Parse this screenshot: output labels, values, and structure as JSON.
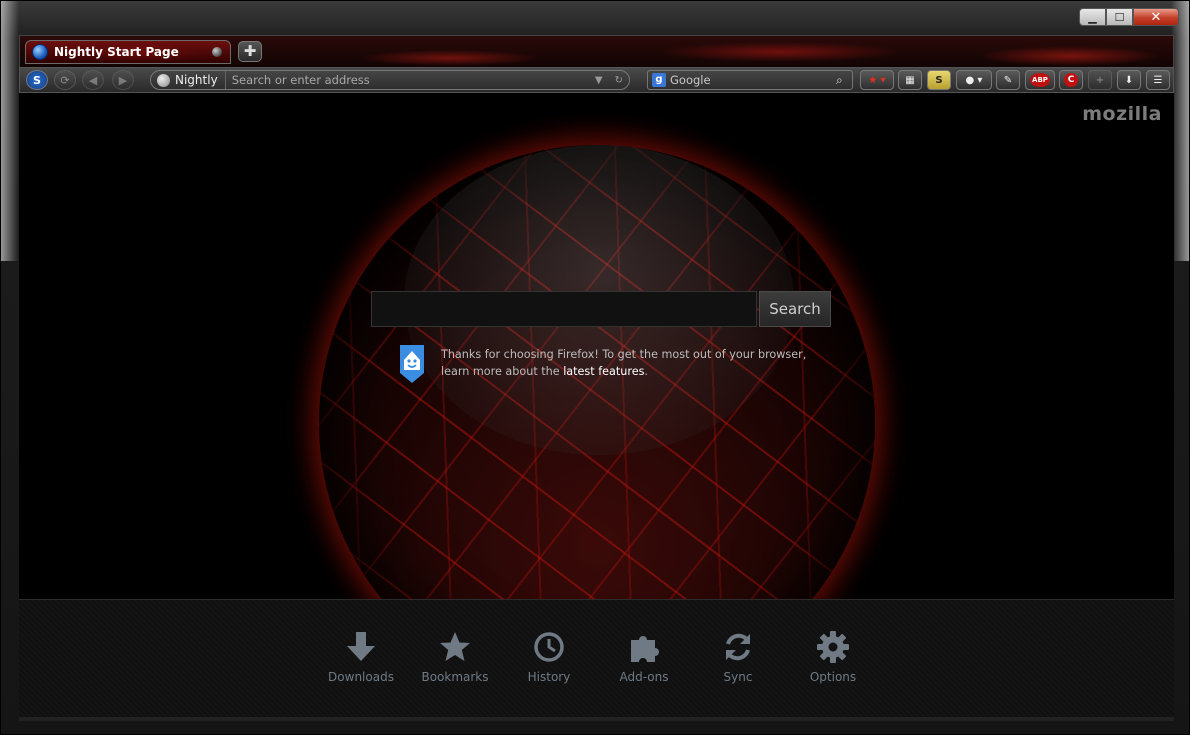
{
  "window": {
    "caption_buttons": {
      "minimize": "▁",
      "maximize": "☐",
      "close": "✕"
    }
  },
  "tabs": [
    {
      "title": "Nightly Start Page",
      "icon": "globe-icon"
    }
  ],
  "new_tab_symbol": "✚",
  "navbar": {
    "identity_label": "Nightly",
    "address_placeholder": "Search or enter address",
    "search_engine": "Google",
    "search_placeholder": "Google",
    "toolbar_icons": [
      "bookmark-star-icon",
      "tile-view-icon",
      "scrapbook-icon",
      "extension-icon",
      "wrench-icon",
      "adblock-plus-icon",
      "c-extension-icon",
      "add-icon",
      "downloads-icon",
      "menu-icon"
    ],
    "abp_label": "ABP",
    "c_label": "C"
  },
  "content": {
    "brand": "mozilla",
    "search_button": "Search",
    "snippet_text": "Thanks for choosing Firefox! To get the most out of your browser, learn more about the ",
    "snippet_link": "latest features",
    "snippet_end": "."
  },
  "launcher": [
    {
      "label": "Downloads",
      "icon": "download-arrow-icon"
    },
    {
      "label": "Bookmarks",
      "icon": "star-icon"
    },
    {
      "label": "History",
      "icon": "clock-icon"
    },
    {
      "label": "Add-ons",
      "icon": "puzzle-icon"
    },
    {
      "label": "Sync",
      "icon": "sync-icon"
    },
    {
      "label": "Options",
      "icon": "gear-icon"
    }
  ],
  "colors": {
    "accent_red": "#b41e14",
    "launcher_label": "#6f7a84"
  }
}
